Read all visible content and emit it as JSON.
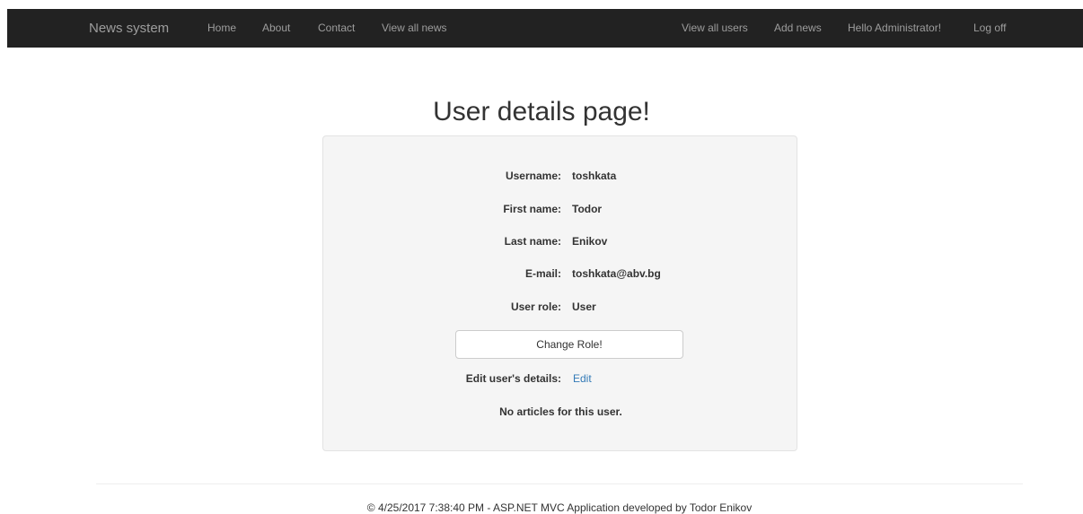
{
  "navbar": {
    "brand": "News system",
    "left_links": [
      "Home",
      "About",
      "Contact",
      "View all news"
    ],
    "right_links": [
      "View all users",
      "Add news",
      "Hello Administrator!",
      "Log off"
    ]
  },
  "page": {
    "title": "User details page!"
  },
  "details": {
    "username_label": "Username:",
    "username_value": "toshkata",
    "first_name_label": "First name:",
    "first_name_value": "Todor",
    "last_name_label": "Last name:",
    "last_name_value": "Enikov",
    "email_label": "E-mail:",
    "email_value": "toshkata@abv.bg",
    "role_label": "User role:",
    "role_value": "User",
    "change_role_button": "Change Role!",
    "edit_details_label": "Edit user's details:",
    "edit_link": "Edit",
    "no_articles": "No articles for this user."
  },
  "footer": {
    "text": "© 4/25/2017 7:38:40 PM - ASP.NET MVC Application developed by Todor Enikov"
  },
  "colors": {
    "navbar_bg": "#222222",
    "nav_text": "#9d9d9d",
    "link": "#337ab7",
    "panel_bg": "#f5f5f5"
  }
}
